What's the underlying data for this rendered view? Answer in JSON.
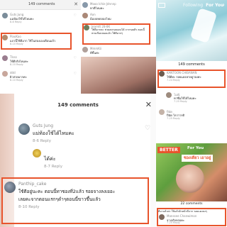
{
  "panel1": {
    "header_title": "149 comments",
    "close_icon": "✕",
    "comments": [
      {
        "name": "Guts Jung",
        "text": "แม่ห้องใช้ได้ไหมคะ",
        "meta": "8-6  Reply"
      },
      {
        "name": "PiaoKao",
        "text": "แถวนี้ใช้ดีมาก ใช้ในสองเองเดือนแล้ว",
        "meta": "8-10  Reply"
      },
      {
        "name": "Tlsss",
        "text": "ใช้ดีจริงไหมคะ",
        "meta": "8-10  Reply"
      },
      {
        "name": "ddd",
        "text": "ผิวสวยมากค่ะ",
        "meta": "8-10  Reply"
      }
    ]
  },
  "panel2": {
    "comments": [
      {
        "name": "Mooo Ichie Jdnnnp",
        "text": "ทาดีไหมคะ",
        "meta": "Reply"
      },
      {
        "name": "Aon",
        "text": "มีแบบทดลองไหม",
        "meta": "Reply"
      },
      {
        "name": "Jeamtt 28-8K",
        "text": "ใช้ดีมากคะ ช่วยลดรอยแดงได้ จากรอยสิว ตอนนี้หายเกือบหมดแล้ว ใช้ดีมากๆ",
        "meta": "Reply"
      },
      {
        "name": "MmmKii",
        "text": "ดีขึ้นค่ะ",
        "meta": "Reply"
      }
    ]
  },
  "panel3": {
    "tabs_following": "Following",
    "tabs_for_you": "For You",
    "count": "149 comments",
    "comments": [
      {
        "name": "KANTOON CHIBANAN",
        "text": "ใช้ดีค่ะ รอยแดงหายดูว่องค่ะ",
        "meta": "7-24  Reply"
      },
      {
        "name": "โม่ณิ",
        "text": "ทาซึ่มใช้ได้ไหมคะ",
        "meta": "7-25  Reply"
      },
      {
        "name": "ปีนัด",
        "text": "ปีนัด ไลวาวรดิ",
        "meta": "7-25  Reply"
      }
    ]
  },
  "panel4": {
    "title": "149 comments",
    "comments": [
      {
        "name": "Guts Jung",
        "text": "แม่ท้องใช้ได้ไหมคะ",
        "meta": "8-6   Reply"
      },
      {
        "name": "",
        "text": "ได้ค่ะ",
        "meta": "8-7   Reply"
      },
      {
        "name": "Panthip_cake",
        "text": "ใช้ดีอยู่นะคะ ตอนนี้ทาซองที่2แล้ว รอยจางลงเยอะ",
        "text2": "เลยคะจากตอนแรกๆดำๆตอนนี้ขาวขึ้นแล้ว",
        "meta": "8-10   Reply"
      }
    ]
  },
  "panel5": {
    "badge": "BETTER",
    "thai_label": "ซองเดียว เอาอยู่",
    "for_you": "For You",
    "count": "22 comments",
    "comments": [
      {
        "name": "",
        "text": "ดีมาแล้วค่ะ ใช้แล้วผิวหน้าดีจาก รอยแดงลงๆ",
        "meta": ""
      },
      {
        "name": "Manssee Chanwimon",
        "text": "จางจริงหรอคะ",
        "meta": "7-25  Reply"
      }
    ]
  }
}
